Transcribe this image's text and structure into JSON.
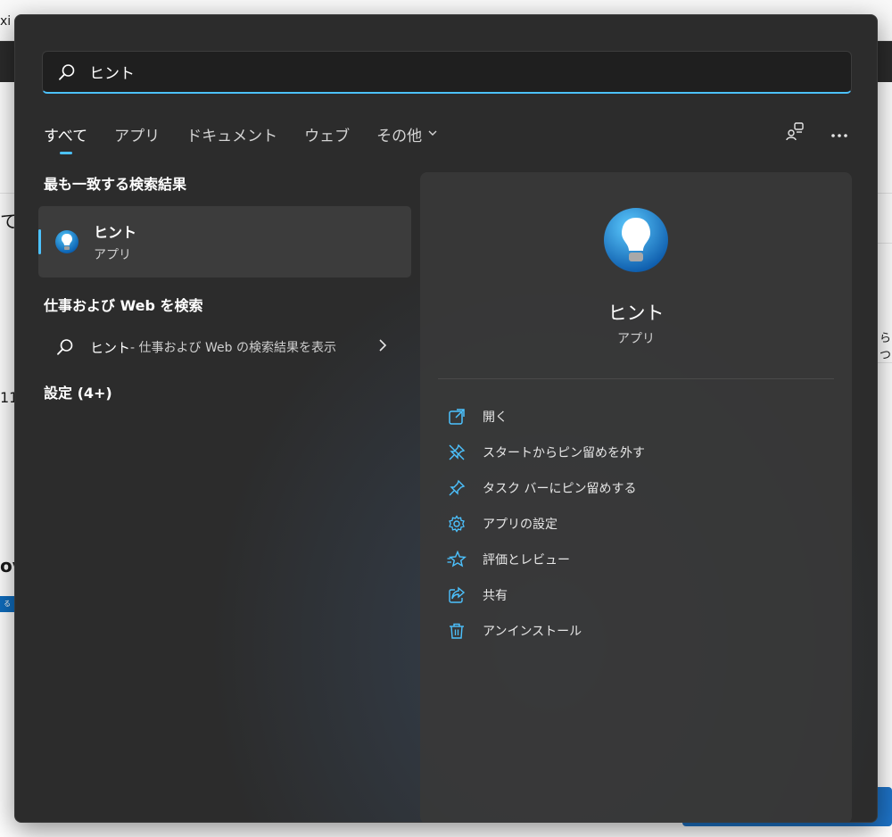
{
  "background": {
    "fragments": [
      "xi",
      "て",
      "11",
      "ov",
      "る",
      "らつ"
    ]
  },
  "search": {
    "value": "ヒント"
  },
  "tabs": [
    {
      "label": "すべて",
      "active": true
    },
    {
      "label": "アプリ",
      "active": false
    },
    {
      "label": "ドキュメント",
      "active": false
    },
    {
      "label": "ウェブ",
      "active": false
    },
    {
      "label": "その他",
      "active": false,
      "dropdown": true
    }
  ],
  "best_match": {
    "section_title": "最も一致する検索結果",
    "name": "ヒント",
    "type": "アプリ",
    "icon": "tips-lightbulb-icon"
  },
  "web_search": {
    "section_title": "仕事および Web を検索",
    "query": "ヒント",
    "suffix": " - 仕事および Web の検索結果を表示"
  },
  "settings": {
    "section_title": "設定 (4+)"
  },
  "detail": {
    "name": "ヒント",
    "type": "アプリ",
    "actions": [
      {
        "label": "開く",
        "icon": "open-external-icon"
      },
      {
        "label": "スタートからピン留めを外す",
        "icon": "unpin-icon"
      },
      {
        "label": "タスク バーにピン留めする",
        "icon": "pin-icon"
      },
      {
        "label": "アプリの設定",
        "icon": "gear-icon"
      },
      {
        "label": "評価とレビュー",
        "icon": "star-review-icon"
      },
      {
        "label": "共有",
        "icon": "share-icon"
      },
      {
        "label": "アンインストール",
        "icon": "trash-icon"
      }
    ]
  },
  "colors": {
    "accent": "#4cc2ff",
    "panel": "#2c2c2c",
    "detail_pane": "#383838"
  }
}
